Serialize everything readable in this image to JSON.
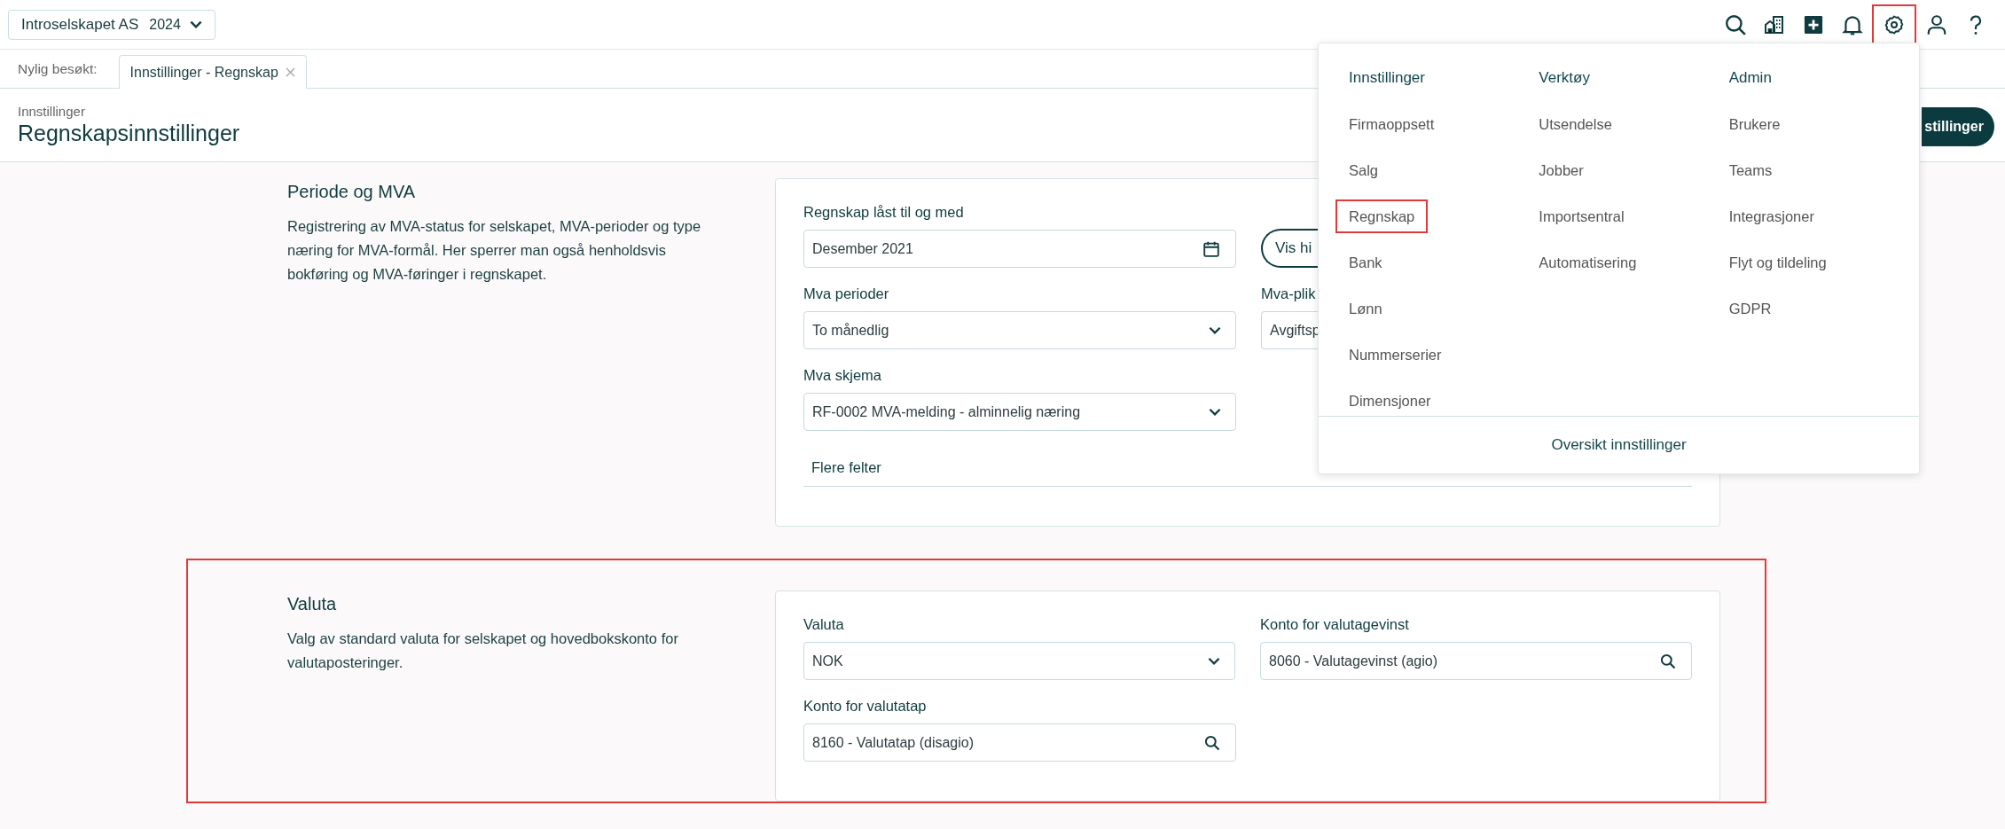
{
  "company_selector": {
    "company": "Introselskapet AS",
    "year": "2024"
  },
  "toolbar": [
    {
      "kind": "search",
      "selected": false
    },
    {
      "kind": "company",
      "selected": false
    },
    {
      "kind": "add",
      "selected": false
    },
    {
      "kind": "notifications",
      "selected": false
    },
    {
      "kind": "settings",
      "selected": true
    },
    {
      "kind": "user",
      "selected": false
    },
    {
      "kind": "help",
      "selected": false
    }
  ],
  "recent": {
    "label": "Nylig besøkt:",
    "tabs": [
      {
        "label": "Innstillinger - Regnskap",
        "selected": true
      }
    ]
  },
  "page_header": {
    "breadcrumb": "Innstillinger",
    "title": "Regnskapsinnstillinger",
    "action_button": "stillinger"
  },
  "sections": [
    {
      "title": "Periode og MVA",
      "description": "Registrering av MVA-status for selskapet, MVA-perioder og type næring for MVA-formål. Her sperrer man også henholdsvis bokføring og MVA-føringer i regnskapet.",
      "highlighted": false,
      "rows": [
        [
          {
            "kind": "date",
            "label": "Regnskap låst til og med",
            "value": "Desember 2021"
          },
          {
            "kind": "button",
            "value": "Vis hi"
          }
        ],
        [
          {
            "kind": "select",
            "label": "Mva perioder",
            "value": "To månedlig"
          },
          {
            "kind": "text",
            "label": "Mva-plik",
            "value": "Avgiftsp"
          }
        ],
        [
          {
            "kind": "select",
            "label": "Mva skjema",
            "value": "RF-0002 MVA-melding - alminnelig næring"
          }
        ]
      ],
      "more_fields": "Flere felter"
    },
    {
      "title": "Valuta",
      "description": "Valg av standard valuta for selskapet og hovedbokskonto for valutaposteringer.",
      "highlighted": true,
      "rows": [
        [
          {
            "kind": "select",
            "label": "Valuta",
            "value": "NOK"
          },
          {
            "kind": "search",
            "label": "Konto for valutagevinst",
            "value": "8060 - Valutagevinst (agio)"
          }
        ],
        [
          {
            "kind": "search",
            "label": "Konto for valutatap",
            "value": "8160 - Valutatap (disagio)"
          }
        ]
      ]
    }
  ],
  "settings_menu": {
    "columns": [
      {
        "heading": "Innstillinger",
        "items": [
          {
            "label": "Firmaoppsett",
            "selected": false
          },
          {
            "label": "Salg",
            "selected": false
          },
          {
            "label": "Regnskap",
            "selected": true
          },
          {
            "label": "Bank",
            "selected": false
          },
          {
            "label": "Lønn",
            "selected": false
          },
          {
            "label": "Nummerserier",
            "selected": false
          },
          {
            "label": "Dimensjoner",
            "selected": false
          }
        ]
      },
      {
        "heading": "Verktøy",
        "items": [
          {
            "label": "Utsendelse",
            "selected": false
          },
          {
            "label": "Jobber",
            "selected": false
          },
          {
            "label": "Importsentral",
            "selected": false
          },
          {
            "label": "Automatisering",
            "selected": false
          }
        ]
      },
      {
        "heading": "Admin",
        "items": [
          {
            "label": "Brukere",
            "selected": false
          },
          {
            "label": "Teams",
            "selected": false
          },
          {
            "label": "Integrasjoner",
            "selected": false
          },
          {
            "label": "Flyt og tildeling",
            "selected": false
          },
          {
            "label": "GDPR",
            "selected": false
          }
        ]
      }
    ],
    "footer_link": "Oversikt innstillinger"
  }
}
